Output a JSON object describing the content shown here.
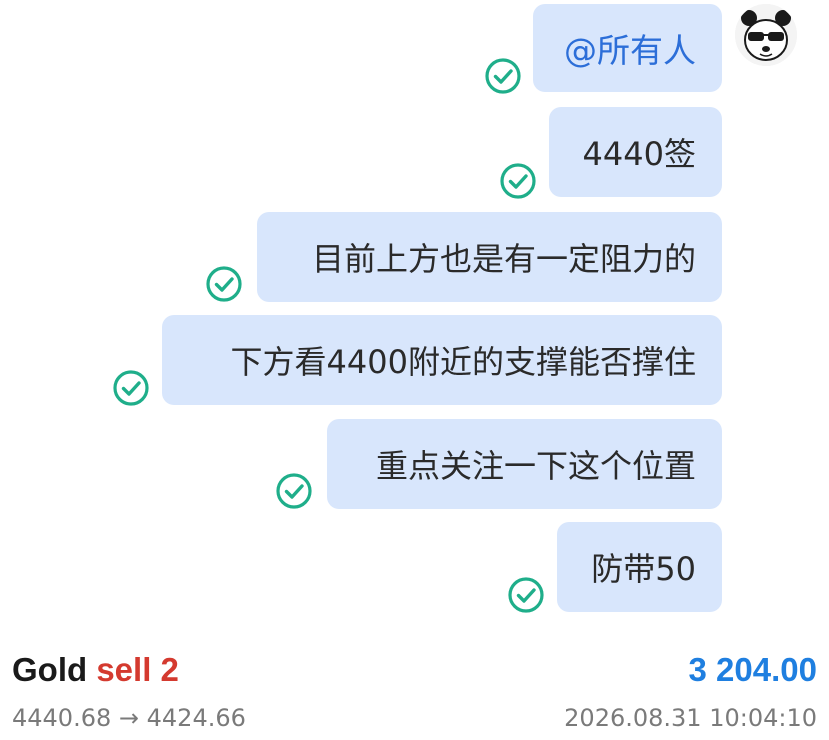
{
  "chat": {
    "messages": [
      {
        "text": "@所有人",
        "mention": true,
        "status": "read-check-icon"
      },
      {
        "text": "4440签",
        "status": "read-check-icon"
      },
      {
        "text": "目前上方也是有一定阻力的",
        "status": "read-check-icon"
      },
      {
        "text": "下方看4400附近的支撑能否撑住",
        "status": "read-check-icon"
      },
      {
        "text": "重点关注一下这个位置",
        "status": "read-check-icon"
      },
      {
        "text": "防带50",
        "status": "read-check-icon"
      }
    ],
    "avatar": "panda-with-sunglasses"
  },
  "trade": {
    "symbol": "Gold",
    "side": "sell",
    "lots": "2",
    "profit": "3 204.00",
    "open_price": "4440.68",
    "arrow": "→",
    "close_price": "4424.66",
    "time": "2026.08.31 10:04:10"
  },
  "colors": {
    "bubble": "#d8e6fc",
    "check": "#1fae8a",
    "sell": "#d43a2f",
    "profit": "#1f7fe0",
    "mention": "#2c6ed8"
  }
}
